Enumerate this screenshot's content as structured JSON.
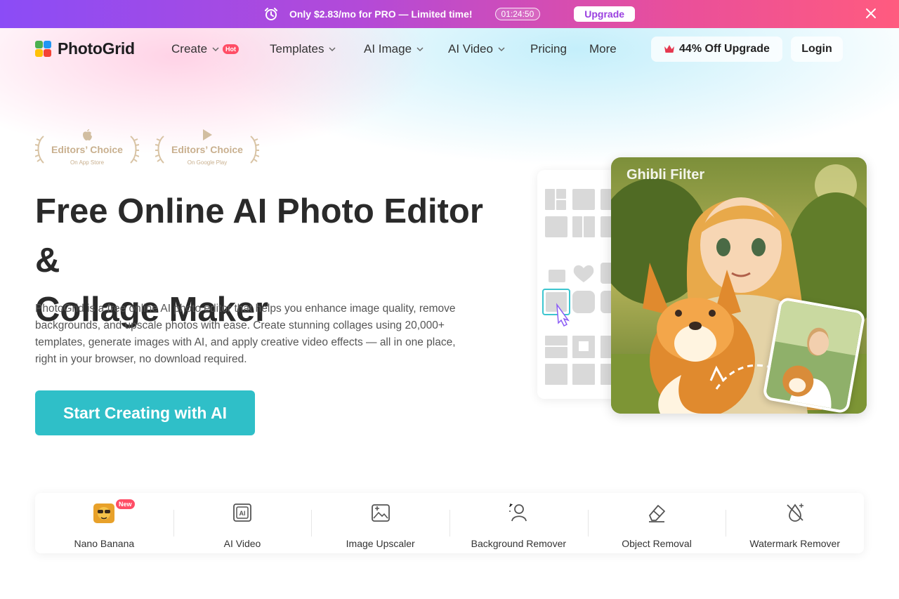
{
  "promo": {
    "text": "Only $2.83/mo for PRO — Limited time!",
    "timer": "01:24:50",
    "upgrade_label": "Upgrade"
  },
  "brand": {
    "name": "PhotoGrid"
  },
  "nav": {
    "items": [
      {
        "label": "Create",
        "badge": "Hot",
        "has_dropdown": true
      },
      {
        "label": "Templates",
        "has_dropdown": true
      },
      {
        "label": "AI Image",
        "has_dropdown": true
      },
      {
        "label": "AI Video",
        "has_dropdown": true
      },
      {
        "label": "Pricing",
        "has_dropdown": false
      },
      {
        "label": "More",
        "has_dropdown": false
      }
    ],
    "offer_label": "44% Off Upgrade",
    "login_label": "Login"
  },
  "awards": [
    {
      "title": "Editors’ Choice",
      "subtitle": "On App Store",
      "icon": "apple-icon"
    },
    {
      "title": "Editors’ Choice",
      "subtitle": "On Google Play",
      "icon": "google-play-icon"
    }
  ],
  "hero": {
    "title_line1": "Free Online AI Photo Editor &",
    "title_line2": "Collage Maker",
    "description": "PhotoGrid is a free online AI photo editor that helps you enhance image quality, remove backgrounds, and upscale photos with ease. Create stunning collages using 20,000+ templates, generate images with AI, and apply creative video effects — all in one place, right in your browser, no download required.",
    "cta_label": "Start Creating with AI",
    "illustration_label": "Ghibli Filter"
  },
  "tools": [
    {
      "label": "Nano Banana",
      "badge": "New",
      "icon": "banana-icon"
    },
    {
      "label": "AI Video",
      "icon": "ai-video-icon"
    },
    {
      "label": "Image Upscaler",
      "icon": "image-upscale-icon"
    },
    {
      "label": "Background Remover",
      "icon": "background-remove-icon"
    },
    {
      "label": "Object Removal",
      "icon": "eraser-icon"
    },
    {
      "label": "Watermark Remover",
      "icon": "watermark-remove-icon"
    }
  ],
  "colors": {
    "accent": "#2fbfc8",
    "badge": "#ff4d66",
    "promo_start": "#8b4cf6",
    "promo_end": "#ff5b7f",
    "award_gold": "#c9b08f"
  }
}
